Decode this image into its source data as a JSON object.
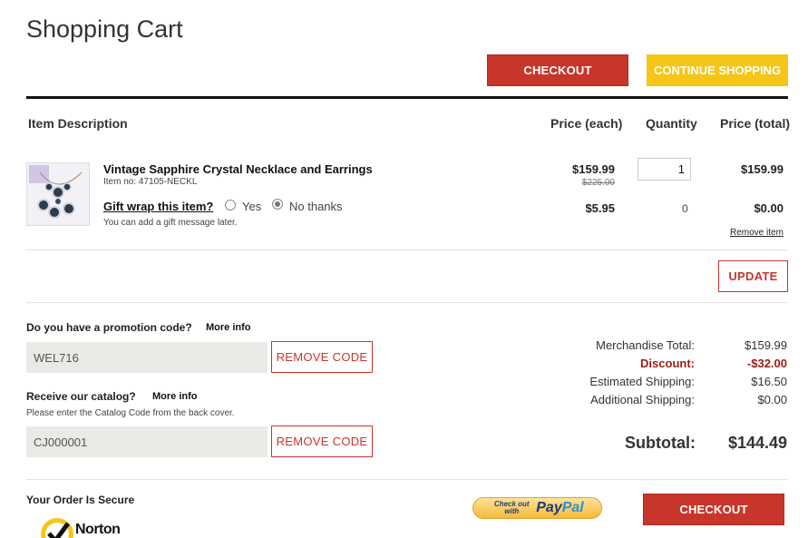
{
  "page": {
    "title": "Shopping Cart"
  },
  "top_buttons": {
    "checkout": "CHECKOUT",
    "continue": "CONTINUE SHOPPING"
  },
  "table_headers": {
    "item": "Item Description",
    "price_each": "Price (each)",
    "quantity": "Quantity",
    "price_total": "Price (total)"
  },
  "item": {
    "name": "Vintage Sapphire Crystal Necklace and Earrings",
    "item_no": "Item no: 47105-NECKL",
    "price_each": "$159.99",
    "price_original": "$225.00",
    "quantity": "1",
    "price_total": "$159.99",
    "remove_label": "Remove item"
  },
  "gift": {
    "label": "Gift wrap this item?",
    "yes_label": "Yes",
    "no_label": "No thanks",
    "selected": "No thanks",
    "note": "You can add a gift message later.",
    "price_each": "$5.95",
    "quantity": "0",
    "price_total": "$0.00"
  },
  "update_button": "UPDATE",
  "promo": {
    "question": "Do you have a promotion code?",
    "more_info": "More info",
    "code": "WEL716",
    "remove_label": "REMOVE CODE"
  },
  "catalog": {
    "question": "Receive our catalog?",
    "more_info": "More info",
    "hint": "Please enter the Catalog Code from the back cover.",
    "code": "CJ000001",
    "remove_label": "REMOVE CODE"
  },
  "summary": {
    "merch_label": "Merchandise Total:",
    "merch_value": "$159.99",
    "discount_label": "Discount:",
    "discount_value": "-$32.00",
    "ship_label": "Estimated Shipping:",
    "ship_value": "$16.50",
    "addl_label": "Additional Shipping:",
    "addl_value": "$0.00",
    "subtotal_label": "Subtotal:",
    "subtotal_value": "$144.49"
  },
  "footer": {
    "secure_label": "Your Order Is Secure",
    "norton_label": "Norton",
    "paypal_small": "Check out with",
    "paypal_brand_pay": "Pay",
    "paypal_brand_pal": "Pal",
    "checkout": "CHECKOUT"
  },
  "colors": {
    "accent_red": "#c8352a",
    "accent_yellow": "#f5c518",
    "discount_red": "#9b1c14"
  }
}
